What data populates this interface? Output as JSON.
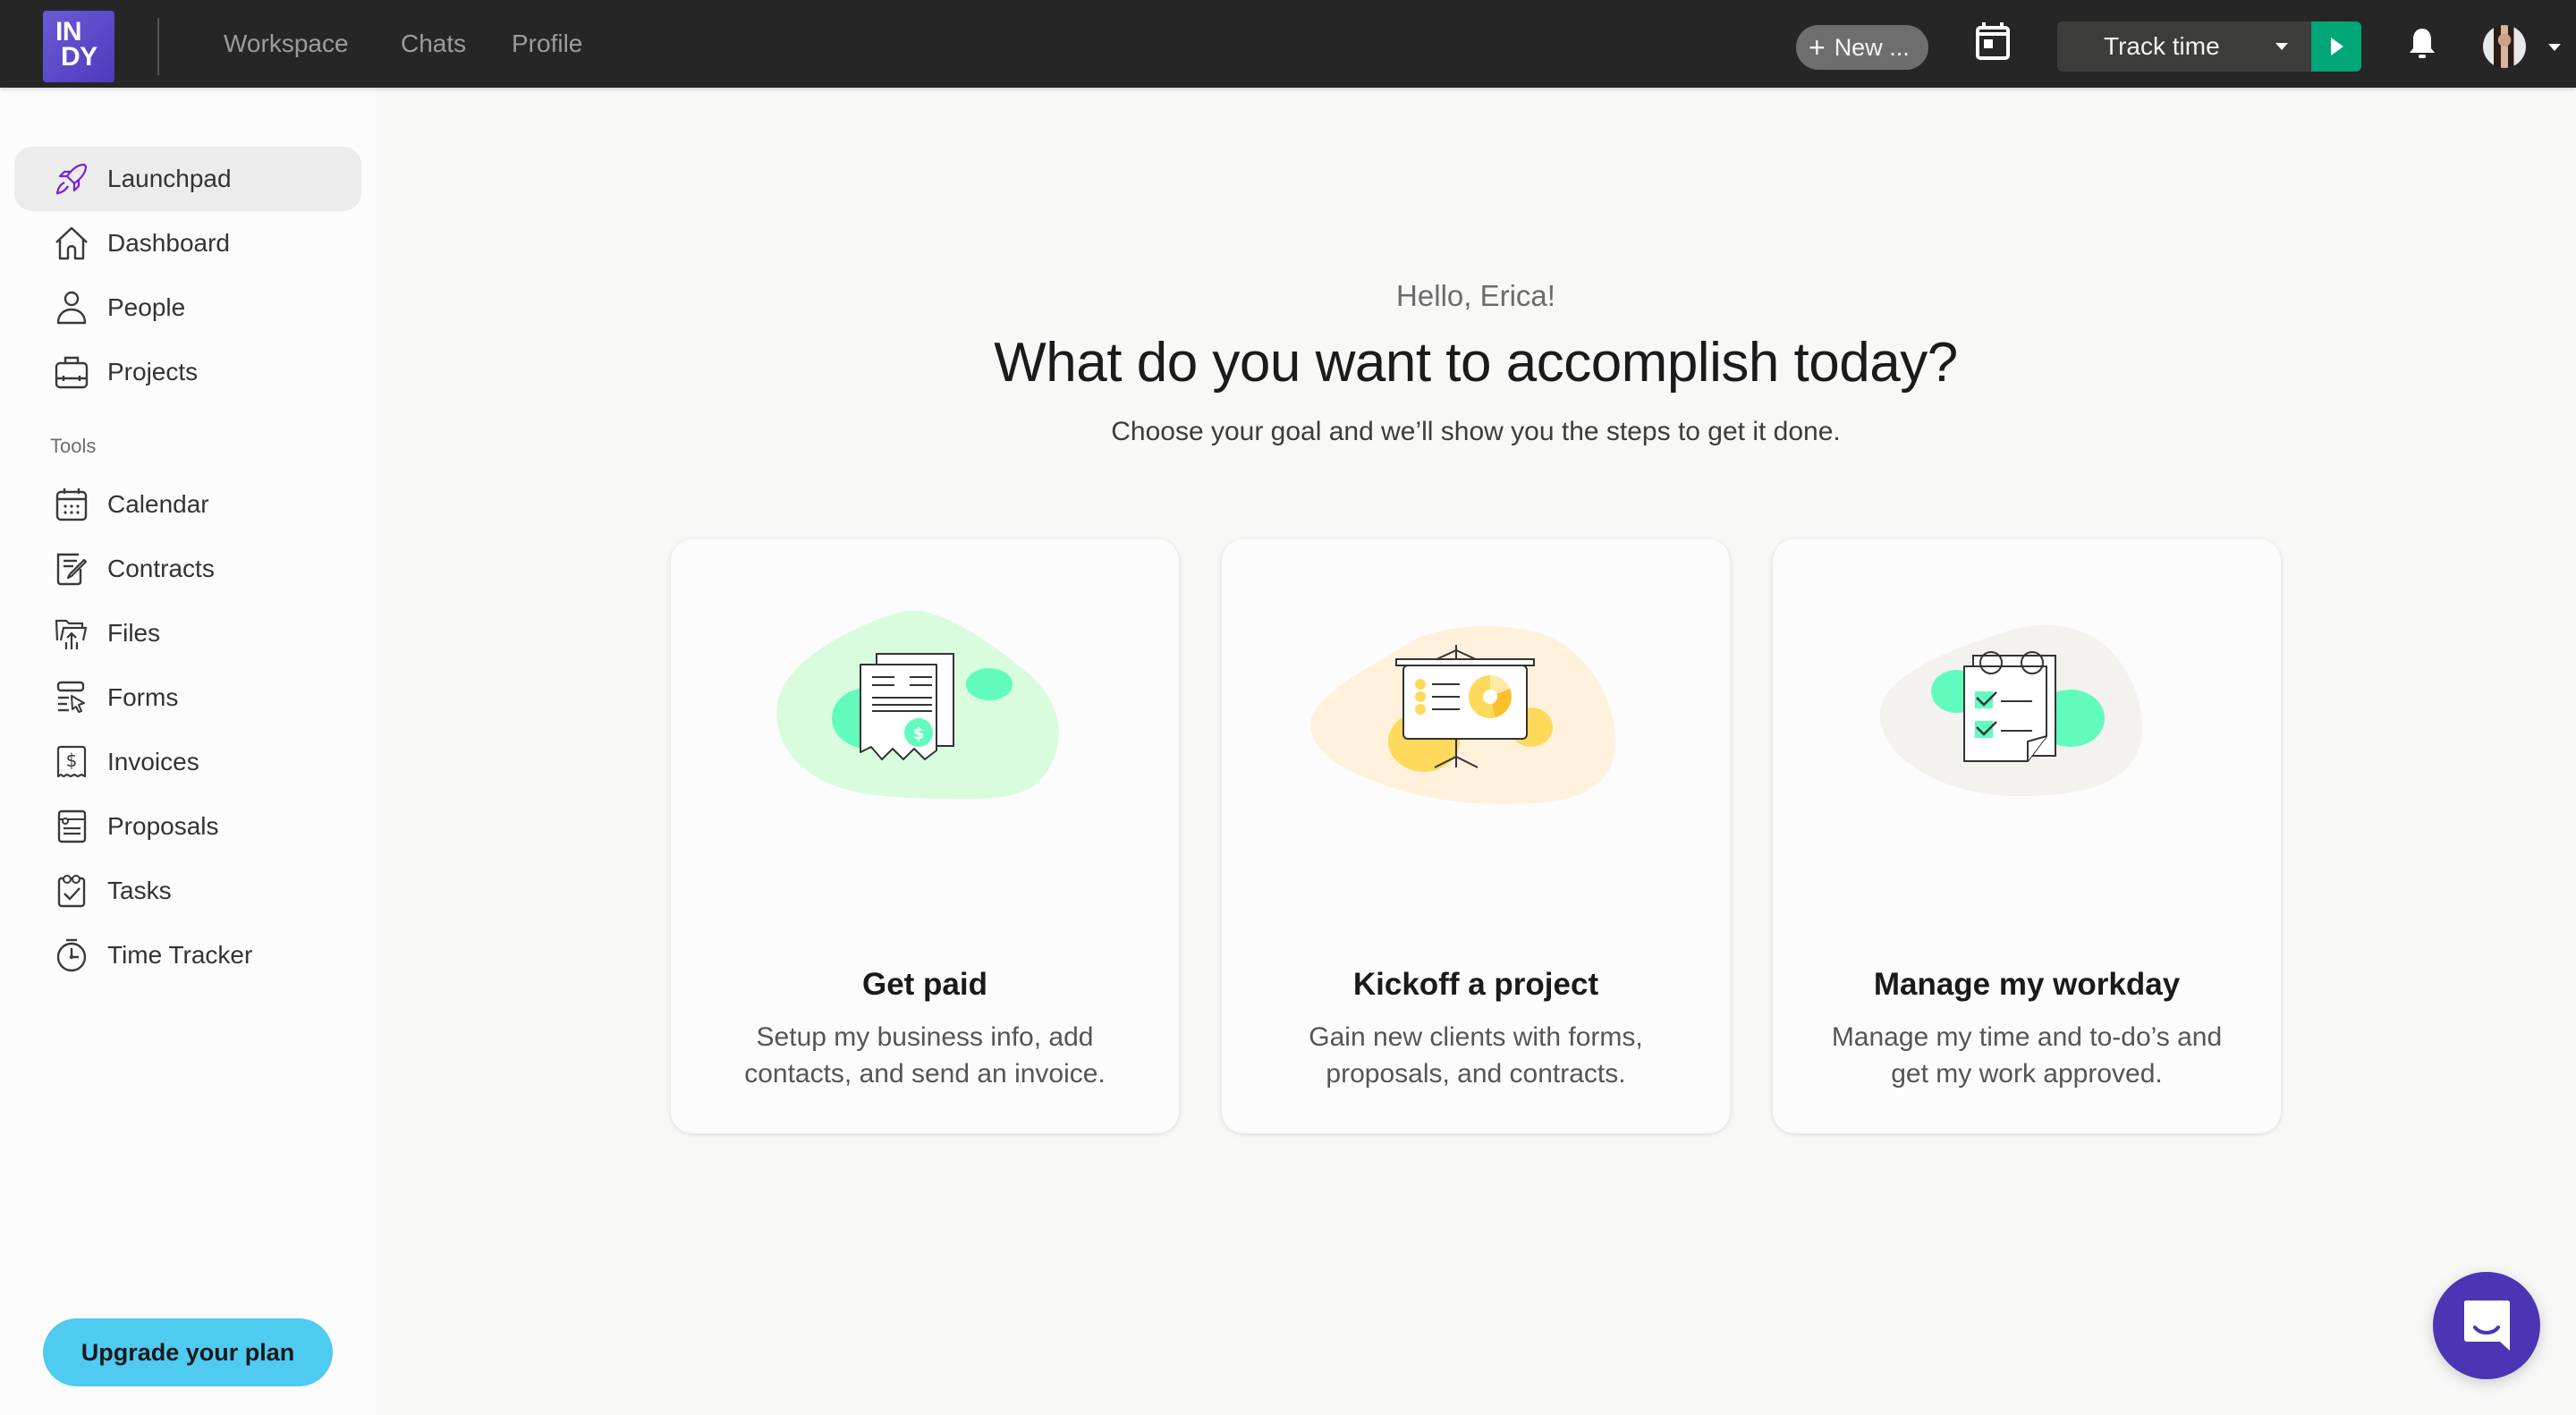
{
  "app": {
    "logo_line1": "IN",
    "logo_line2": "DY",
    "brand_color": "#5a47c9"
  },
  "topbar": {
    "nav": [
      {
        "label": "Workspace"
      },
      {
        "label": "Chats"
      },
      {
        "label": "Profile"
      }
    ],
    "new_button": {
      "icon": "plus-icon",
      "label": "New ..."
    },
    "calendar_icon": "calendar-icon",
    "track_time": {
      "label": "Track time",
      "play_color": "#00a676"
    },
    "bell_icon": "bell-icon",
    "avatar": "user-avatar"
  },
  "sidebar": {
    "items": [
      {
        "label": "Launchpad",
        "icon": "rocket-icon",
        "active": true
      },
      {
        "label": "Dashboard",
        "icon": "home-icon"
      },
      {
        "label": "People",
        "icon": "person-icon"
      },
      {
        "label": "Projects",
        "icon": "briefcase-icon"
      }
    ],
    "tools_label": "Tools",
    "tools": [
      {
        "label": "Calendar",
        "icon": "calendar-icon"
      },
      {
        "label": "Contracts",
        "icon": "contract-icon"
      },
      {
        "label": "Files",
        "icon": "folder-upload-icon"
      },
      {
        "label": "Forms",
        "icon": "form-icon"
      },
      {
        "label": "Invoices",
        "icon": "invoice-icon"
      },
      {
        "label": "Proposals",
        "icon": "proposal-icon"
      },
      {
        "label": "Tasks",
        "icon": "tasks-icon"
      },
      {
        "label": "Time Tracker",
        "icon": "stopwatch-icon"
      }
    ],
    "upgrade_label": "Upgrade your plan",
    "upgrade_color": "#4fcaf0"
  },
  "main": {
    "greeting": "Hello, Erica!",
    "headline": "What do you want to accomplish today?",
    "subtitle": "Choose your goal and we’ll show you the steps to get it done.",
    "cards": [
      {
        "title": "Get paid",
        "description": "Setup my business info, add contacts, and send an invoice.",
        "illustration": "invoice-illustration",
        "accent": "#62fbbe"
      },
      {
        "title": "Kickoff a project",
        "description": "Gain new clients with forms, proposals, and contracts.",
        "illustration": "presentation-illustration",
        "accent": "#ffd95c"
      },
      {
        "title": "Manage my workday",
        "description": "Manage my time and to-do’s and get my work approved.",
        "illustration": "checklist-illustration",
        "accent": "#62fbbe"
      }
    ]
  },
  "chat_widget": {
    "icon": "chat-icon",
    "color": "#4b35b5"
  }
}
